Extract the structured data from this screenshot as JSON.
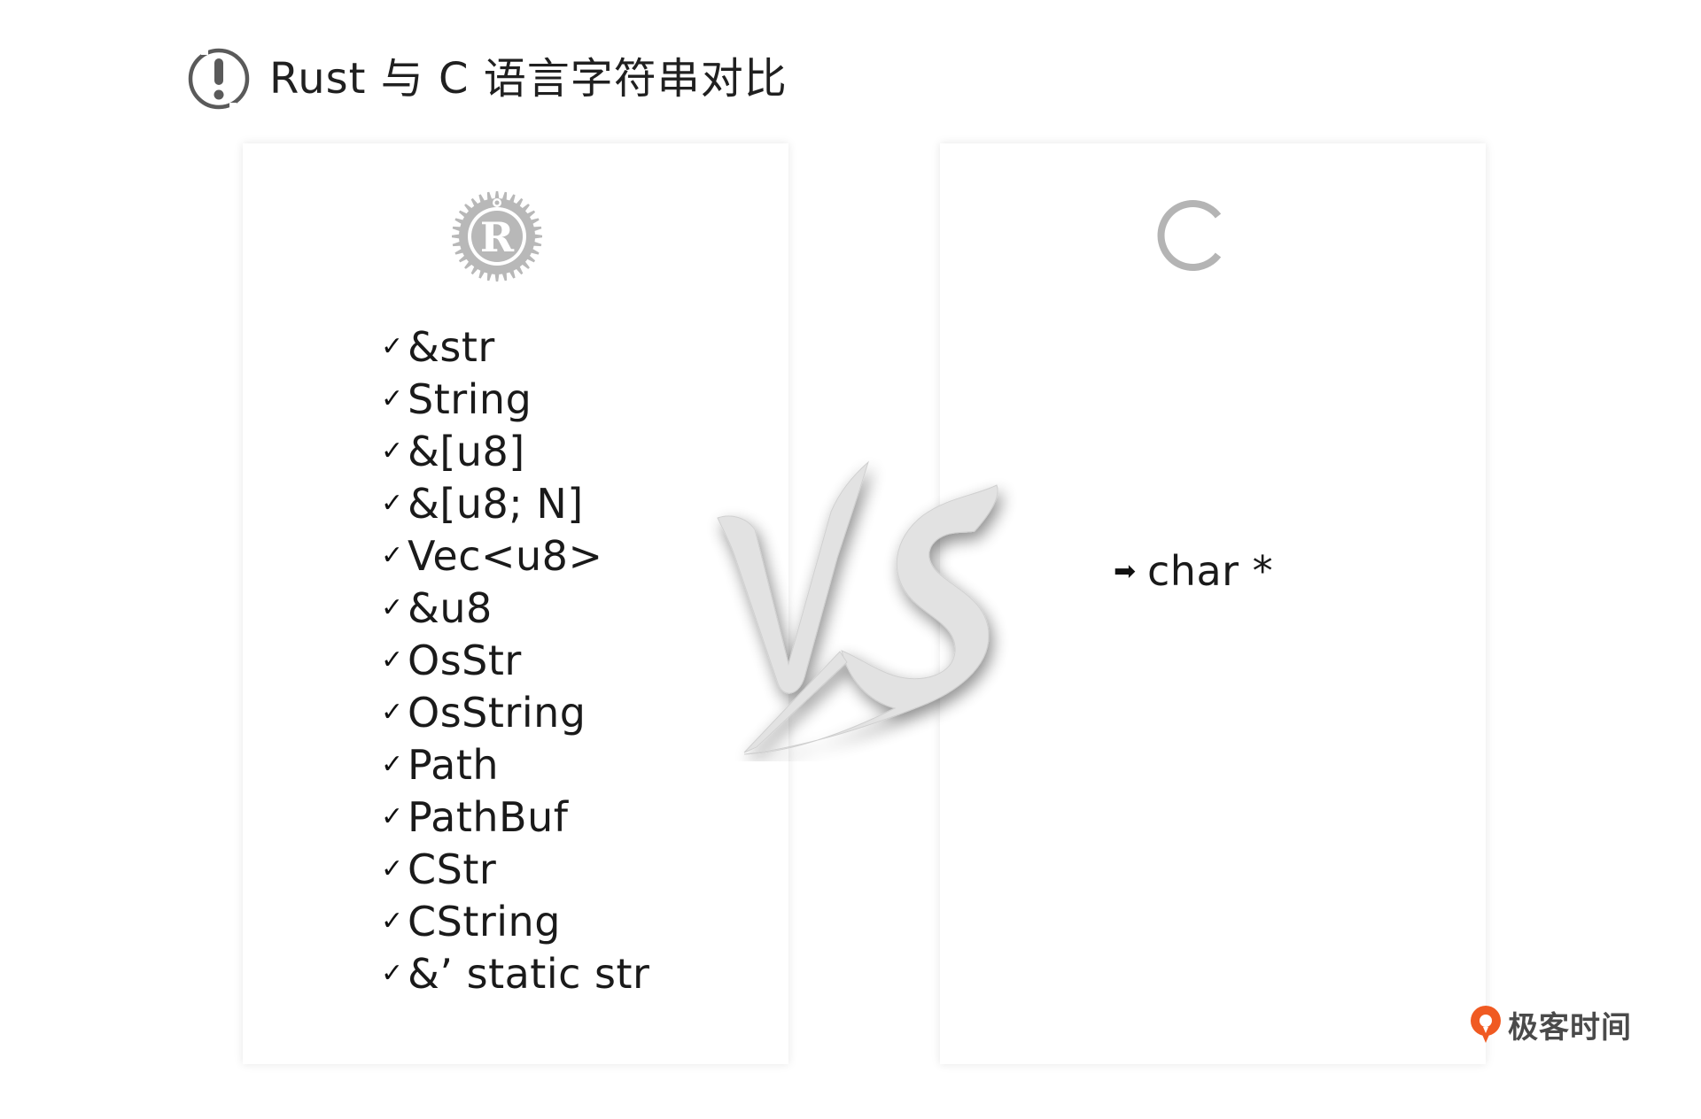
{
  "header": {
    "icon": "exclamation-circle-icon",
    "title": "Rust 与 C 语言字符串对比"
  },
  "rust_card": {
    "logo_icon": "rust-logo-icon",
    "marker": "✓",
    "items": [
      {
        "label": "&str"
      },
      {
        "label": "String"
      },
      {
        "label": "&[u8]"
      },
      {
        "label": "&[u8; N]"
      },
      {
        "label": "Vec<u8>"
      },
      {
        "label": "&u8"
      },
      {
        "label": "OsStr"
      },
      {
        "label": "OsString"
      },
      {
        "label": "Path"
      },
      {
        "label": "PathBuf"
      },
      {
        "label": "CStr"
      },
      {
        "label": "CString"
      },
      {
        "label": "&’ static str"
      }
    ]
  },
  "c_card": {
    "logo_icon": "c-logo-icon",
    "marker": "➡",
    "item": "char *"
  },
  "vs": {
    "icon": "vs-brush-icon"
  },
  "brand": {
    "icon": "geektime-logo-icon",
    "text": "极客时间"
  },
  "colors": {
    "logo_gray": "#b4b4b4",
    "vs_gray": "#e4e4e4",
    "brand_orange": "#f05a22",
    "text": "#1a1a1a"
  }
}
